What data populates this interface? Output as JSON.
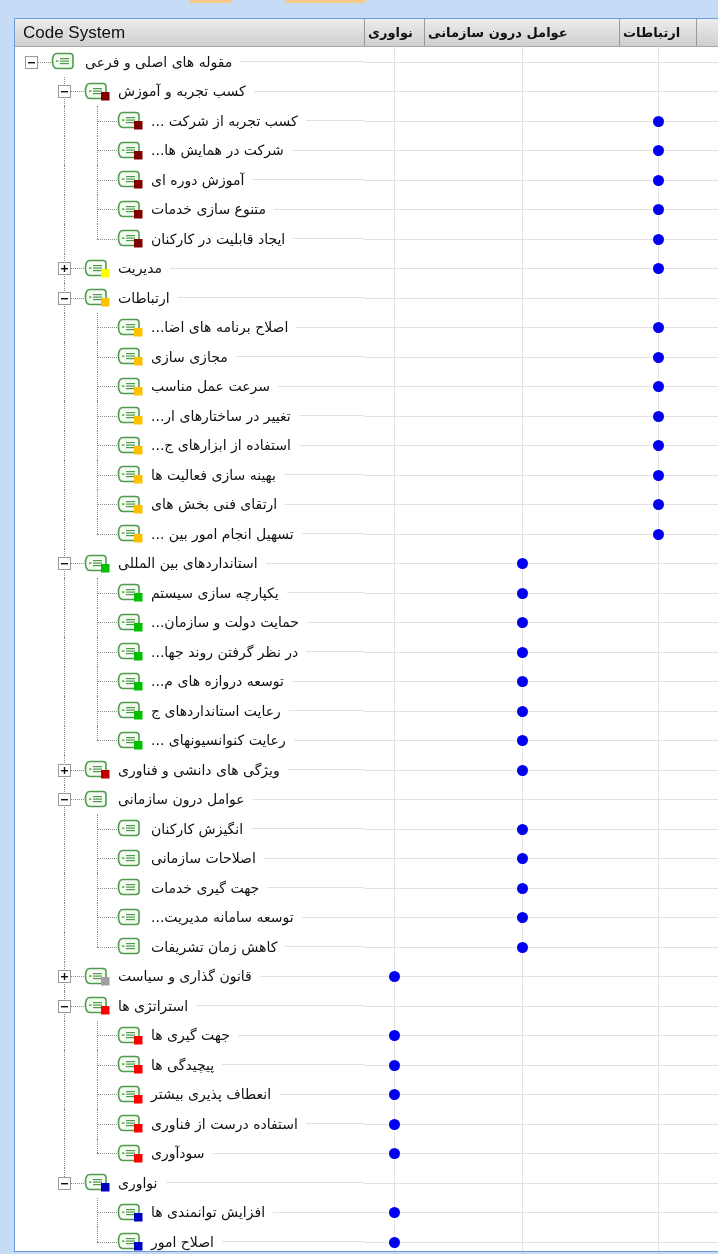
{
  "header": {
    "title": "Code System",
    "columns": [
      "ارتباطات",
      "عوامل درون سازمانی",
      "نواوری"
    ]
  },
  "tree": [
    {
      "label": "مقوله های اصلی و فرعی",
      "expanded": true,
      "hits": [
        false,
        false,
        false
      ],
      "children": [
        {
          "label": "کسب تجربه و آموزش",
          "color": "#800000",
          "expanded": true,
          "hits": [
            false,
            false,
            false
          ],
          "children": [
            {
              "label": "کسب تجربه از شرکت ...",
              "color": "#800000",
              "hits": [
                true,
                false,
                false
              ]
            },
            {
              "label": "شرکت در همایش ها...",
              "color": "#800000",
              "hits": [
                true,
                false,
                false
              ]
            },
            {
              "label": "آموزش دوره ای",
              "color": "#800000",
              "hits": [
                true,
                false,
                false
              ]
            },
            {
              "label": "متنوع سازی خدمات",
              "color": "#800000",
              "hits": [
                true,
                false,
                false
              ]
            },
            {
              "label": "ایجاد قابلیت در کارکنان",
              "color": "#800000",
              "hits": [
                true,
                false,
                false
              ]
            }
          ]
        },
        {
          "label": "مدیریت",
          "color": "#ffff00",
          "expanded": false,
          "hits": [
            true,
            false,
            false
          ]
        },
        {
          "label": "ارتباطات",
          "color": "#ffc000",
          "expanded": true,
          "hits": [
            false,
            false,
            false
          ],
          "children": [
            {
              "label": "اصلاح برنامه های اضا...",
              "color": "#ffc000",
              "hits": [
                true,
                false,
                false
              ]
            },
            {
              "label": "مجازی سازی",
              "color": "#ffc000",
              "hits": [
                true,
                false,
                false
              ]
            },
            {
              "label": "سرعت عمل مناسب",
              "color": "#ffc000",
              "hits": [
                true,
                false,
                false
              ]
            },
            {
              "label": "تغییر در ساختارهای ار...",
              "color": "#ffc000",
              "hits": [
                true,
                false,
                false
              ]
            },
            {
              "label": "استفاده از ابزارهای ج...",
              "color": "#ffc000",
              "hits": [
                true,
                false,
                false
              ]
            },
            {
              "label": "بهینه سازی فعالیت ها",
              "color": "#ffc000",
              "hits": [
                true,
                false,
                false
              ]
            },
            {
              "label": "ارتقای فنی بخش های",
              "color": "#ffc000",
              "hits": [
                true,
                false,
                false
              ]
            },
            {
              "label": "تسهیل انجام امور بین ...",
              "color": "#ffc000",
              "hits": [
                true,
                false,
                false
              ]
            }
          ]
        },
        {
          "label": "استانداردهای بین المللی",
          "color": "#00c000",
          "expanded": true,
          "hits": [
            false,
            true,
            false
          ],
          "children": [
            {
              "label": "یکپارچه سازی سیستم",
              "color": "#00c000",
              "hits": [
                false,
                true,
                false
              ]
            },
            {
              "label": "حمایت دولت و سازمان...",
              "color": "#00c000",
              "hits": [
                false,
                true,
                false
              ]
            },
            {
              "label": "در نظر گرفتن روند جها...",
              "color": "#00c000",
              "hits": [
                false,
                true,
                false
              ]
            },
            {
              "label": "توسعه دروازه های م...",
              "color": "#00c000",
              "hits": [
                false,
                true,
                false
              ]
            },
            {
              "label": "رعایت استانداردهای ج",
              "color": "#00c000",
              "hits": [
                false,
                true,
                false
              ]
            },
            {
              "label": "رعایت کنوانسیونهای ...",
              "color": "#00c000",
              "hits": [
                false,
                true,
                false
              ]
            }
          ]
        },
        {
          "label": "ویژگی های دانشی و فناوری",
          "color": "#c00000",
          "expanded": false,
          "hits": [
            false,
            true,
            false
          ]
        },
        {
          "label": "عوامل درون سازمانی",
          "expanded": true,
          "hits": [
            false,
            false,
            false
          ],
          "children": [
            {
              "label": "انگیزش کارکنان",
              "hits": [
                false,
                true,
                false
              ]
            },
            {
              "label": "اصلاحات سازمانی",
              "hits": [
                false,
                true,
                false
              ]
            },
            {
              "label": "جهت گیری خدمات",
              "hits": [
                false,
                true,
                false
              ]
            },
            {
              "label": "توسعه سامانه مدیریت...",
              "hits": [
                false,
                true,
                false
              ]
            },
            {
              "label": "کاهش زمان تشریفات",
              "hits": [
                false,
                true,
                false
              ]
            }
          ]
        },
        {
          "label": "قانون گذاری و سیاست",
          "color": "#a0a0a0",
          "expanded": false,
          "hits": [
            false,
            false,
            true
          ]
        },
        {
          "label": "استراتژی ها",
          "color": "#ff0000",
          "expanded": true,
          "hits": [
            false,
            false,
            false
          ],
          "children": [
            {
              "label": "جهت گیری ها",
              "color": "#ff0000",
              "hits": [
                false,
                false,
                true
              ]
            },
            {
              "label": "پیچیدگی ها",
              "color": "#ff0000",
              "hits": [
                false,
                false,
                true
              ]
            },
            {
              "label": "انعطاف پذیری بیشتر",
              "color": "#ff0000",
              "hits": [
                false,
                false,
                true
              ]
            },
            {
              "label": "استفاده درست از فناوری",
              "color": "#ff0000",
              "hits": [
                false,
                false,
                true
              ]
            },
            {
              "label": "سودآوری",
              "color": "#ff0000",
              "hits": [
                false,
                false,
                true
              ]
            }
          ]
        },
        {
          "label": "نواوری",
          "color": "#0000c0",
          "expanded": true,
          "hits": [
            false,
            false,
            false
          ],
          "children": [
            {
              "label": "افزایش توانمندی ها",
              "color": "#0000c0",
              "hits": [
                false,
                false,
                true
              ]
            },
            {
              "label": "اصلاح امور",
              "color": "#0000c0",
              "hits": [
                false,
                false,
                true
              ]
            }
          ]
        }
      ]
    }
  ]
}
